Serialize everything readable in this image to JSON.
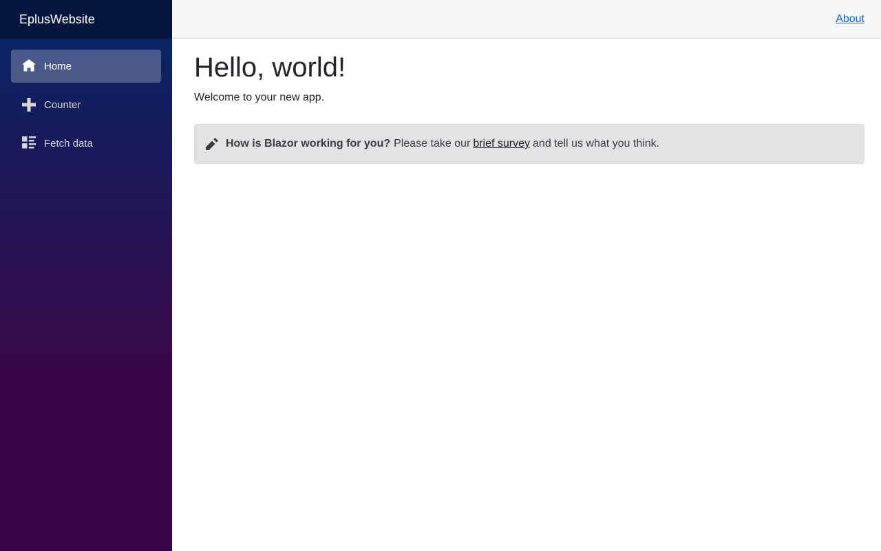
{
  "sidebar": {
    "brand": "EplusWebsite",
    "items": [
      {
        "label": "Home",
        "icon": "home-icon",
        "active": true
      },
      {
        "label": "Counter",
        "icon": "plus-icon",
        "active": false
      },
      {
        "label": "Fetch data",
        "icon": "list-rich-icon",
        "active": false
      }
    ]
  },
  "header": {
    "about_label": "About"
  },
  "main": {
    "title": "Hello, world!",
    "subtitle": "Welcome to your new app.",
    "survey": {
      "icon": "pencil-icon",
      "question": "How is Blazor working for you?",
      "prefix": "Please take our",
      "link_text": "brief survey",
      "suffix": "and tell us what you think."
    }
  },
  "colors": {
    "sidebar_top": "#052767",
    "sidebar_bottom": "#3a0647",
    "link": "#0366d6",
    "alert_bg": "#e2e3e5"
  }
}
